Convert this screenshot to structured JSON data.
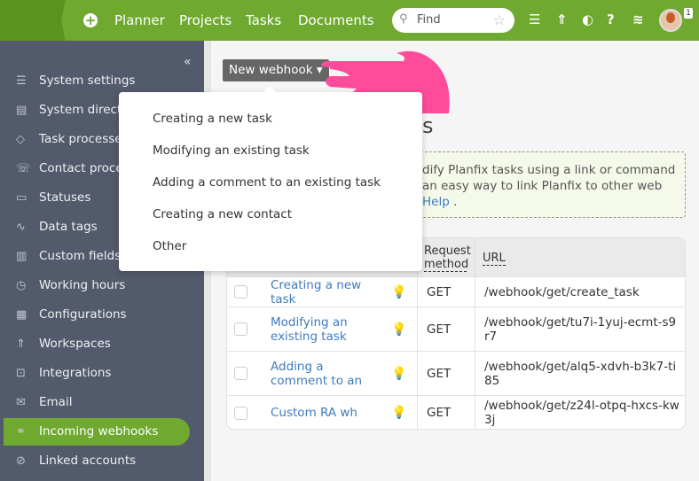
{
  "topbar": {
    "nav": [
      "Planner",
      "Projects",
      "Tasks",
      "Documents"
    ],
    "search_placeholder": "Find",
    "notifications": "1"
  },
  "sidebar": {
    "items": [
      {
        "label": "System settings",
        "icon": "sliders-icon"
      },
      {
        "label": "System directories",
        "icon": "directory-icon"
      },
      {
        "label": "Task processes",
        "icon": "process-icon"
      },
      {
        "label": "Contact processes",
        "icon": "contact-process-icon"
      },
      {
        "label": "Statuses",
        "icon": "statuses-icon"
      },
      {
        "label": "Data tags",
        "icon": "tags-icon"
      },
      {
        "label": "Custom fields",
        "icon": "fields-icon"
      },
      {
        "label": "Working hours",
        "icon": "clock-icon"
      },
      {
        "label": "Configurations",
        "icon": "configurations-icon"
      },
      {
        "label": "Workspaces",
        "icon": "rocket-icon"
      },
      {
        "label": "Integrations",
        "icon": "integrations-icon"
      },
      {
        "label": "Email",
        "icon": "email-icon"
      },
      {
        "label": "Incoming webhooks",
        "icon": "webhook-icon",
        "active": true
      },
      {
        "label": "Linked accounts",
        "icon": "linked-icon"
      }
    ]
  },
  "main": {
    "new_webhook": "New webhook ▾",
    "title_fragment": "s",
    "info": {
      "line1": "dify Planfix tasks using a link or command",
      "line2": "an easy way to link Planfix to other web",
      "help": "Help",
      "tail": " ."
    },
    "table": {
      "headers": {
        "method": "Request method",
        "url": "URL"
      },
      "rows": [
        {
          "name": "Creating a new task",
          "method": "GET",
          "url": "/webhook/get/create_task"
        },
        {
          "name": "Modifying an existing task",
          "method": "GET",
          "url": "/webhook/get/tu7i-1yuj-ecmt-s9r7"
        },
        {
          "name": "Adding a comment to an existing task",
          "method": "GET",
          "url": "/webhook/get/alq5-xdvh-b3k7-ti85"
        },
        {
          "name": "Custom RA wh",
          "method": "GET",
          "url": "/webhook/get/z24l-otpq-hxcs-kw3j"
        }
      ]
    }
  },
  "menu": {
    "items": [
      "Creating a new task",
      "Modifying an existing task",
      "Adding a comment to an existing task",
      "Creating a new contact",
      "Other"
    ]
  },
  "colors": {
    "brand": "#6fa92f",
    "sidebar": "#535a6b",
    "link": "#3f7bbf",
    "pointer": "#ff4b9b"
  }
}
